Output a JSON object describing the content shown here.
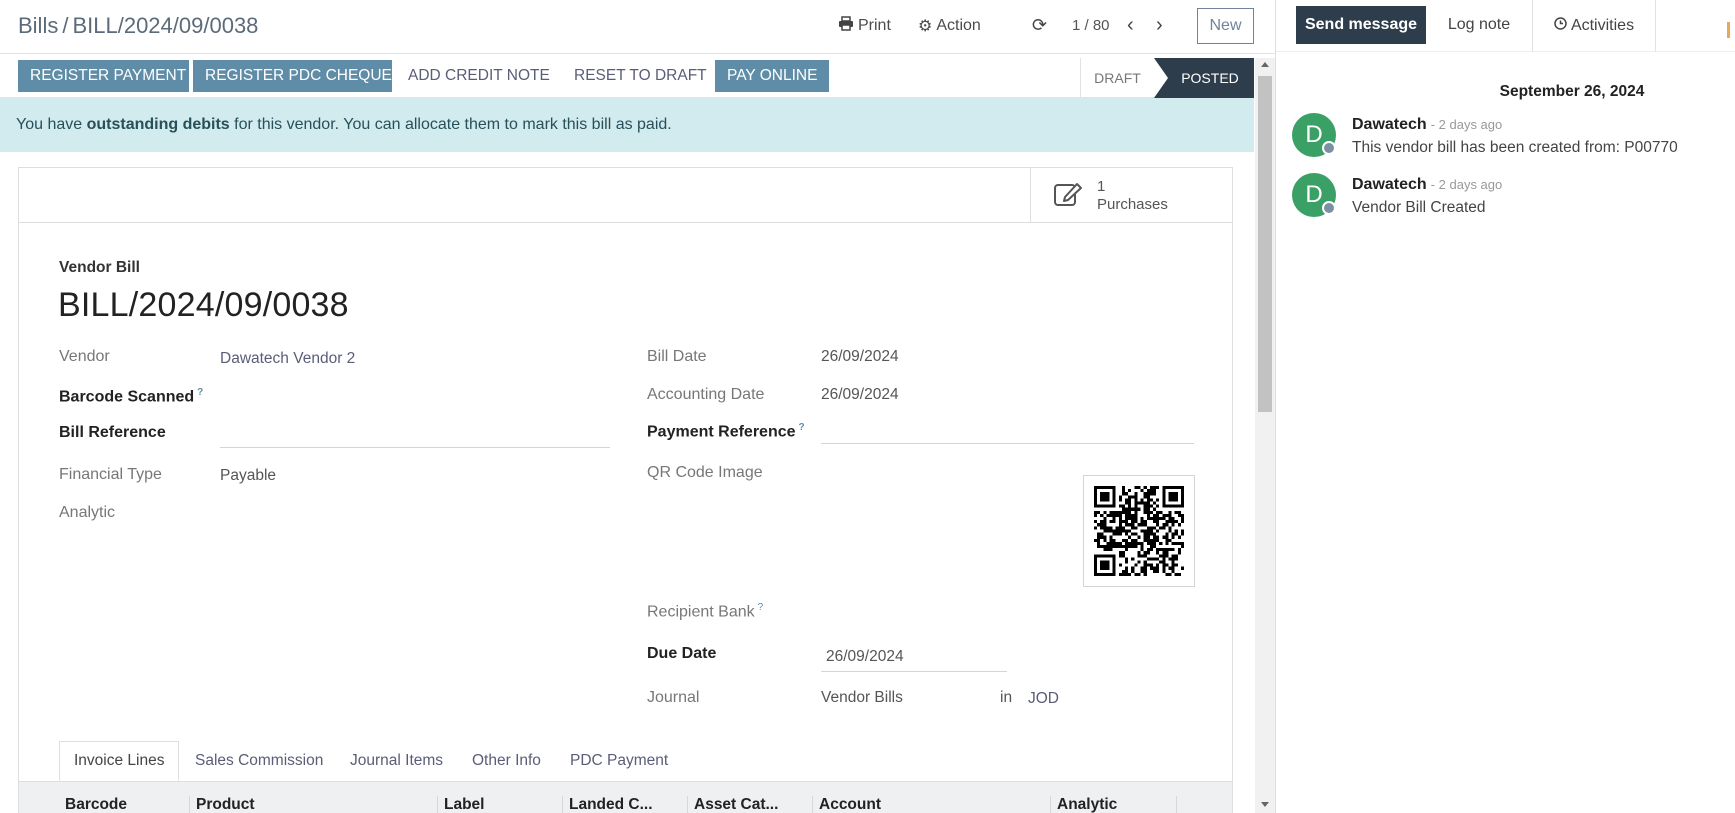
{
  "breadcrumb": {
    "parent": "Bills",
    "separator": "/",
    "current": "BILL/2024/09/0038"
  },
  "control_panel": {
    "print_label": "Print",
    "action_label": "Action",
    "pager_text": "1 / 80",
    "new_label": "New"
  },
  "statusbar": {
    "buttons": [
      {
        "label": "REGISTER PAYMENT",
        "style": "primary"
      },
      {
        "label": "REGISTER PDC CHEQUE",
        "style": "primary"
      },
      {
        "label": "ADD CREDIT NOTE",
        "style": "secondary"
      },
      {
        "label": "RESET TO DRAFT",
        "style": "secondary"
      },
      {
        "label": "PAY ONLINE",
        "style": "primary"
      }
    ],
    "stages": {
      "draft": "DRAFT",
      "posted": "POSTED"
    },
    "current_stage": "POSTED"
  },
  "alert": {
    "prefix": "You have ",
    "bold": "outstanding debits",
    "suffix": " for this vendor. You can allocate them to mark this bill as paid."
  },
  "smart_button": {
    "count": "1",
    "label": "Purchases",
    "icon": "edit-icon"
  },
  "form": {
    "type_label": "Vendor Bill",
    "name": "BILL/2024/09/0038",
    "left_fields": {
      "vendor_label": "Vendor",
      "vendor_value": "Dawatech Vendor 2",
      "barcode_label": "Barcode Scanned",
      "barcode_help": "?",
      "bill_ref_label": "Bill Reference",
      "financial_type_label": "Financial Type",
      "financial_type_value": "Payable",
      "analytic_label": "Analytic"
    },
    "right_fields": {
      "bill_date_label": "Bill Date",
      "bill_date_value": "26/09/2024",
      "accounting_date_label": "Accounting Date",
      "accounting_date_value": "26/09/2024",
      "payment_ref_label": "Payment Reference",
      "payment_ref_help": "?",
      "qr_label": "QR Code Image",
      "recipient_bank_label": "Recipient Bank",
      "recipient_bank_help": "?",
      "due_date_label": "Due Date",
      "due_date_value": "26/09/2024",
      "journal_label": "Journal",
      "journal_value": "Vendor Bills",
      "journal_in": "in",
      "journal_currency": "JOD"
    }
  },
  "tabs": [
    "Invoice Lines",
    "Sales Commission",
    "Journal Items",
    "Other Info",
    "PDC Payment"
  ],
  "active_tab": "Invoice Lines",
  "table_headers": [
    "Barcode",
    "Product",
    "Label",
    "Landed C...",
    "Asset Cat...",
    "Account",
    "Analytic"
  ],
  "chatter": {
    "send_message_label": "Send message",
    "log_note_label": "Log note",
    "activities_label": "Activities",
    "date_separator": "September 26, 2024",
    "messages": [
      {
        "author": "Dawatech",
        "avatar_letter": "D",
        "time": "- 2 days ago",
        "body": "This vendor bill has been created from: P00770"
      },
      {
        "author": "Dawatech",
        "avatar_letter": "D",
        "time": "- 2 days ago",
        "body": "Vendor Bill Created"
      }
    ]
  },
  "colors": {
    "primary_button": "#5f8da8",
    "posted_stage": "#2d3d4c",
    "alert_background": "#d2ebee",
    "avatar": "#3aa065",
    "link": "#5a5d78"
  }
}
